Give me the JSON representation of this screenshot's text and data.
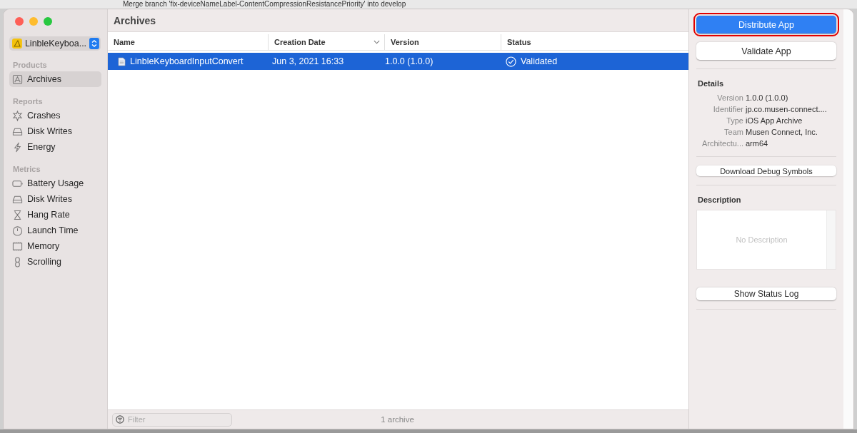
{
  "backdrop": {
    "text": "Merge branch 'fix-deviceNameLabel-ContentCompressionResistancePriority' into develop"
  },
  "sidebar": {
    "scheme": {
      "label": "LinbleKeyboa..."
    },
    "sections": [
      {
        "title": "Products",
        "items": [
          {
            "label": "Archives",
            "selected": true
          }
        ]
      },
      {
        "title": "Reports",
        "items": [
          {
            "label": "Crashes",
            "selected": false
          },
          {
            "label": "Disk Writes",
            "selected": false
          },
          {
            "label": "Energy",
            "selected": false
          }
        ]
      },
      {
        "title": "Metrics",
        "items": [
          {
            "label": "Battery Usage",
            "selected": false
          },
          {
            "label": "Disk Writes",
            "selected": false
          },
          {
            "label": "Hang Rate",
            "selected": false
          },
          {
            "label": "Launch Time",
            "selected": false
          },
          {
            "label": "Memory",
            "selected": false
          },
          {
            "label": "Scrolling",
            "selected": false
          }
        ]
      }
    ]
  },
  "main": {
    "title": "Archives",
    "table": {
      "columns": [
        {
          "label": "Name",
          "sorted": false
        },
        {
          "label": "Creation Date",
          "sorted": true
        },
        {
          "label": "Version",
          "sorted": false
        },
        {
          "label": "Status",
          "sorted": false
        }
      ],
      "rows": [
        {
          "name": "LinbleKeyboardInputConvert",
          "creation_date": "Jun 3, 2021 16:33",
          "version": "1.0.0 (1.0.0)",
          "status": "Validated",
          "selected": true
        }
      ]
    },
    "filter": {
      "placeholder": "Filter"
    },
    "count": "1 archive"
  },
  "inspector": {
    "primary_button": {
      "label": "Distribute App",
      "highlighted": true
    },
    "secondary_button": {
      "label": "Validate App"
    },
    "details": {
      "title": "Details",
      "rows": [
        {
          "label": "Version",
          "value": "1.0.0 (1.0.0)"
        },
        {
          "label": "Identifier",
          "value": "jp.co.musen-connect...."
        },
        {
          "label": "Type",
          "value": "iOS App Archive"
        },
        {
          "label": "Team",
          "value": "Musen Connect, Inc."
        },
        {
          "label": "Architectu...",
          "value": "arm64"
        }
      ]
    },
    "debug_button": {
      "label": "Download Debug Symbols"
    },
    "description": {
      "title": "Description",
      "placeholder": "No Description"
    },
    "status_log_button": {
      "label": "Show Status Log"
    }
  }
}
